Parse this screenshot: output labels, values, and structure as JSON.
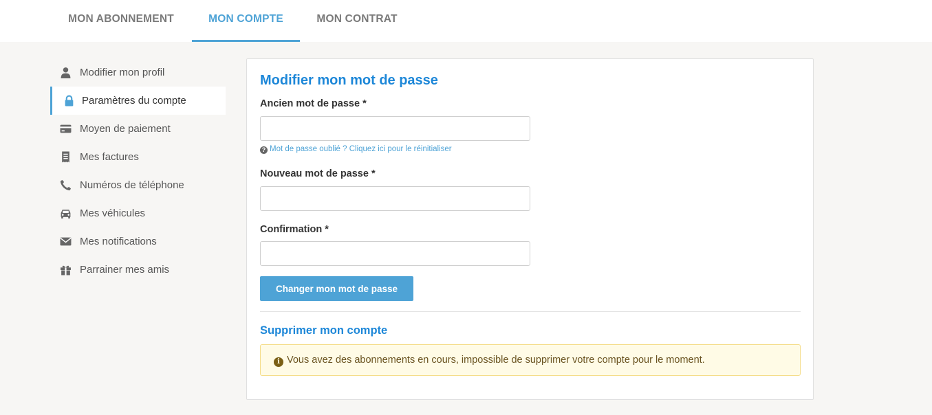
{
  "top_tabs": [
    {
      "label": "MON ABONNEMENT"
    },
    {
      "label": "MON COMPTE"
    },
    {
      "label": "MON CONTRAT"
    }
  ],
  "active_tab": "MON COMPTE",
  "accent_color": "#4ea3d6",
  "sidebar": {
    "items": [
      {
        "label": "Modifier mon profil",
        "icon": "user-icon"
      },
      {
        "label": "Paramètres du compte",
        "icon": "lock-icon"
      },
      {
        "label": "Moyen de paiement",
        "icon": "credit-card-icon"
      },
      {
        "label": "Mes factures",
        "icon": "receipt-icon"
      },
      {
        "label": "Numéros de téléphone",
        "icon": "phone-icon"
      },
      {
        "label": "Mes véhicules",
        "icon": "car-icon"
      },
      {
        "label": "Mes notifications",
        "icon": "envelope-icon"
      },
      {
        "label": "Parrainer mes amis",
        "icon": "gift-icon"
      }
    ],
    "active": "Paramètres du compte"
  },
  "password_form": {
    "title": "Modifier mon mot de passe",
    "old_label": "Ancien mot de passe *",
    "old_value": "",
    "forgot_link": "Mot de passe oublié ? Cliquez ici pour le réinitialiser",
    "new_label": "Nouveau mot de passe *",
    "new_value": "",
    "confirm_label": "Confirmation *",
    "confirm_value": "",
    "submit_label": "Changer mon mot de passe"
  },
  "delete_section": {
    "title": "Supprimer mon compte",
    "warning": "Vous avez des abonnements en cours, impossible de supprimer votre compte pour le moment."
  }
}
